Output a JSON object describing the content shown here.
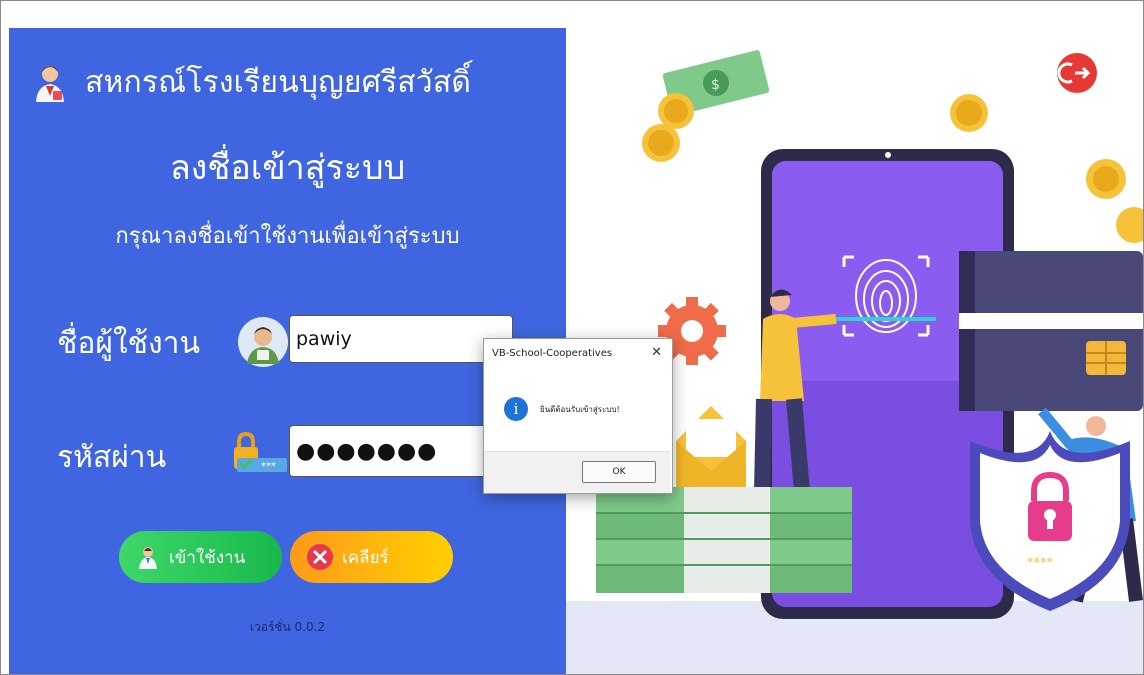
{
  "window": {
    "title": "VB-School-Cooperatives"
  },
  "login": {
    "org_name": "สหกรณ์โรงเรียนบุญยศรีสวัสดิ์",
    "heading": "ลงชื่อเข้าสู่ระบบ",
    "subheading": "กรุณาลงชื่อเข้าใช้งานเพื่อเข้าสู่ระบบ",
    "username_label": "ชื่อผู้ใช้งาน",
    "username_value": "pawiy",
    "password_label": "รหัสผ่าน",
    "password_value": "●●●●●●●",
    "login_button": "เข้าใช้งาน",
    "clear_button": "เคลียร์",
    "version": "เวอร์ชั่น 0.0.2"
  },
  "dialog": {
    "title": "VB-School-Cooperatives",
    "close": "✕",
    "info_icon": "i",
    "message": "ยินดีต้อนรับเข้าสู่ระบบ!",
    "ok_label": "OK"
  },
  "illustration": {
    "icons": [
      "money-bill-icon",
      "coin-icon",
      "gear-icon",
      "fingerprint-icon",
      "credit-card-icon",
      "envelope-icon",
      "shield-lock-icon",
      "logout-icon"
    ],
    "shield_stars": "****",
    "colors": {
      "panel": "#3f66e0",
      "phone": "#7a4ee0",
      "exit": "#e53935",
      "money": "#7fc98a"
    }
  }
}
